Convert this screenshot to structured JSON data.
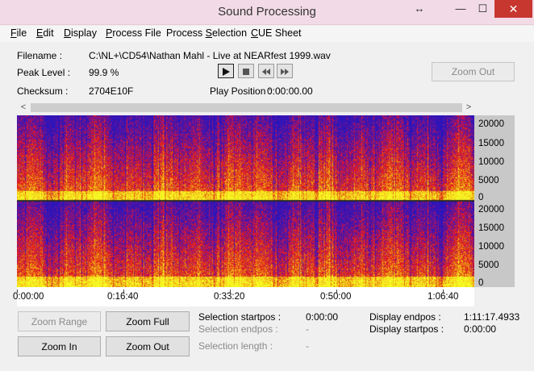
{
  "window": {
    "title": "Sound Processing",
    "resize_glyph": "↔",
    "minimize_glyph": "—",
    "maximize_glyph": "☐",
    "close_glyph": "✕"
  },
  "menu": [
    {
      "underline": "F",
      "rest": "ile"
    },
    {
      "underline": "E",
      "rest": "dit"
    },
    {
      "underline": "D",
      "rest": "isplay"
    },
    {
      "underline": "P",
      "rest": "rocess File"
    },
    {
      "underline": "",
      "rest": "Process ",
      "underline2": "S",
      "rest2": "election"
    },
    {
      "underline": "C",
      "rest": "UE Sheet"
    }
  ],
  "info": {
    "filename_label": "Filename :",
    "filename_value": "C:\\NL+\\CD54\\Nathan Mahl - Live at NEARfest 1999.wav",
    "peak_label": "Peak Level :",
    "peak_value": "99.9 %",
    "checksum_label": "Checksum :",
    "checksum_value": "2704E10F",
    "playpos_label": "Play Position :",
    "playpos_value": "0:00:00.00"
  },
  "playback": {
    "play_icon": "play-icon",
    "stop_icon": "stop-icon",
    "rewind_icon": "rewind-icon",
    "forward_icon": "fast-forward-icon"
  },
  "zoom_out_top": "Zoom Out",
  "spectrogram": {
    "freq_labels_top": [
      "20000",
      "15000",
      "10000",
      "5000",
      "0"
    ],
    "freq_labels_bottom": [
      "20000",
      "15000",
      "10000",
      "5000",
      "0"
    ],
    "time_labels": [
      "0:00:00",
      "0:16:40",
      "0:33:20",
      "0:50:00",
      "1:06:40"
    ],
    "colors": {
      "low": "#2a1cc0",
      "mid": "#d81818",
      "high": "#f4ec12"
    }
  },
  "buttons": {
    "zoom_range": "Zoom Range",
    "zoom_full": "Zoom Full",
    "zoom_in": "Zoom In",
    "zoom_out": "Zoom Out"
  },
  "selection": {
    "startpos_label": "Selection startpos :",
    "startpos_value": "0:00:00",
    "endpos_label": "Selection endpos :",
    "endpos_value": "-",
    "length_label": "Selection length :",
    "length_value": "-"
  },
  "display": {
    "endpos_label": "Display endpos :",
    "endpos_value": "1:11:17.4933",
    "startpos_label": "Display startpos :",
    "startpos_value": "0:00:00"
  }
}
